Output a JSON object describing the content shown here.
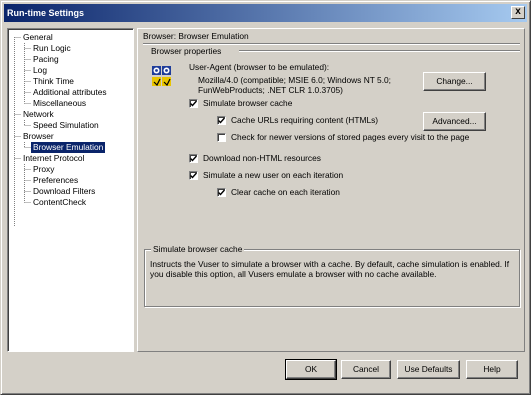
{
  "window": {
    "title": "Run-time Settings",
    "close_glyph": "x"
  },
  "tree": {
    "groups": [
      {
        "label": "General",
        "children": [
          "Run Logic",
          "Pacing",
          "Log",
          "Think Time",
          "Additional attributes",
          "Miscellaneous"
        ]
      },
      {
        "label": "Network",
        "children": [
          "Speed Simulation"
        ]
      },
      {
        "label": "Browser",
        "children": [
          "Browser Emulation"
        ]
      },
      {
        "label": "Internet Protocol",
        "children": [
          "Proxy",
          "Preferences",
          "Download Filters",
          "ContentCheck"
        ]
      }
    ],
    "selected": "Browser Emulation"
  },
  "panel": {
    "heading": "Browser: Browser Emulation",
    "section_label": "Browser properties",
    "user_agent_label": "User-Agent (browser to be emulated):",
    "user_agent_value_line1": "Mozilla/4.0 (compatible; MSIE 6.0; Windows NT 5.0;",
    "user_agent_value_line2": "FunWebProducts; .NET CLR 1.0.3705)",
    "change_button": "Change...",
    "simulate_cache": "Simulate browser cache",
    "cache_urls": "Cache URLs requiring content (HTMLs)",
    "advanced_button": "Advanced...",
    "check_newer": "Check for newer versions of stored pages every visit to the page",
    "download_non_html": "Download non-HTML resources",
    "simulate_new_user": "Simulate a new user on each iteration",
    "clear_cache": "Clear cache on each iteration",
    "checks": {
      "simulate_cache": true,
      "cache_urls": true,
      "check_newer": false,
      "download_non_html": true,
      "simulate_new_user": true,
      "clear_cache": true
    }
  },
  "description": {
    "title": "Simulate browser cache",
    "text": "Instructs the Vuser to simulate a browser with a cache. By default, cache simulation is enabled. If you disable this option, all Vusers emulate a browser with no cache available."
  },
  "footer": {
    "ok": "OK",
    "cancel": "Cancel",
    "use_defaults": "Use Defaults",
    "help": "Help"
  },
  "icons": {
    "browser_icon": "browser-emulation-icon",
    "check_icon": "checkmark-icon"
  }
}
